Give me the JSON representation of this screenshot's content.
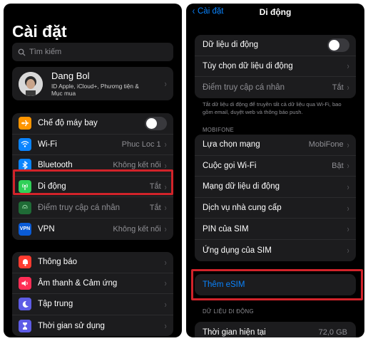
{
  "left": {
    "title": "Cài đặt",
    "search_placeholder": "Tìm kiếm",
    "profile": {
      "name": "Dang Bol",
      "subtitle": "ID Apple, iCloud+, Phương tiện & Mục mua"
    },
    "network_items": [
      {
        "label": "Chế độ máy bay",
        "value": "",
        "icon": "airplane-icon",
        "color": "#ff9500",
        "toggle": true
      },
      {
        "label": "Wi-Fi",
        "value": "Phuc Loc 1",
        "icon": "wifi-icon",
        "color": "#0a84ff"
      },
      {
        "label": "Bluetooth",
        "value": "Không kết nối",
        "icon": "bluetooth-icon",
        "color": "#0a84ff"
      },
      {
        "label": "Di động",
        "value": "Tắt",
        "icon": "cellular-antenna-icon",
        "color": "#30d158"
      },
      {
        "label": "Điểm truy cập cá nhân",
        "value": "Tắt",
        "icon": "personal-hotspot-icon",
        "color": "#1f6b36"
      },
      {
        "label": "VPN",
        "value": "Không kết nối",
        "icon": "vpn-icon",
        "color": "#0a5bd6"
      }
    ],
    "notify_items": [
      {
        "label": "Thông báo",
        "icon": "bell-icon",
        "color": "#ff3b30"
      },
      {
        "label": "Âm thanh & Cảm ứng",
        "icon": "speaker-icon",
        "color": "#ff2d55"
      },
      {
        "label": "Tập trung",
        "icon": "moon-icon",
        "color": "#5e5ce6"
      },
      {
        "label": "Thời gian sử dụng",
        "icon": "hourglass-icon",
        "color": "#5e5ce6"
      }
    ]
  },
  "right": {
    "back_label": "Cài đặt",
    "title": "Di động",
    "group1": [
      {
        "label": "Dữ liệu di động",
        "value": "",
        "toggle": true
      },
      {
        "label": "Tùy chọn dữ liệu di động",
        "value": ""
      },
      {
        "label": "Điểm truy cập cá nhân",
        "value": "Tắt",
        "dim": true
      }
    ],
    "note": "Tắt dữ liệu di động để truyền tất cả dữ liệu qua Wi-Fi, bao gồm email, duyệt web và thông báo push.",
    "section_carrier": "MOBIFONE",
    "group2": [
      {
        "label": "Lựa chọn mạng",
        "value": "MobiFone"
      },
      {
        "label": "Cuộc gọi Wi-Fi",
        "value": "Bật"
      },
      {
        "label": "Mạng dữ liệu di động",
        "value": ""
      },
      {
        "label": "Dịch vụ nhà cung cấp",
        "value": ""
      },
      {
        "label": "PIN của SIM",
        "value": ""
      },
      {
        "label": "Ứng dụng của SIM",
        "value": ""
      }
    ],
    "add_esim": "Thêm eSIM",
    "section_data": "DỮ LIỆU DI ĐỘNG",
    "current_period": {
      "label": "Thời gian hiện tại",
      "value": "72,0 GB"
    }
  },
  "colors": {
    "highlight": "#d2232a",
    "link": "#0a84ff"
  }
}
